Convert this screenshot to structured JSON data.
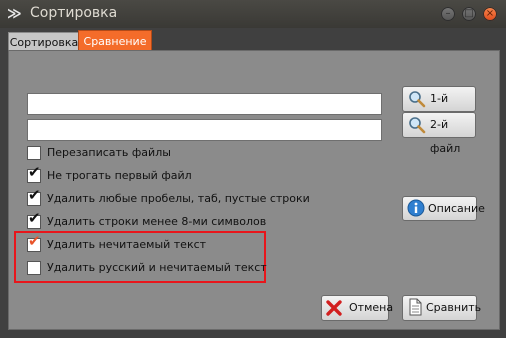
{
  "window": {
    "title": "Сортировка"
  },
  "tabs": [
    {
      "label": "Сортировка",
      "active": false
    },
    {
      "label": "Сравнение",
      "active": true
    }
  ],
  "fields": {
    "file1_value": "",
    "file2_value": ""
  },
  "buttons": {
    "file1": "1-й файл",
    "file2": "2-й файл",
    "description": "Описание",
    "cancel": "Отмена",
    "compare": "Сравнить"
  },
  "options": [
    {
      "label": "Перезаписать файлы",
      "checked": false
    },
    {
      "label": "Не трогать первый файл",
      "checked": true
    },
    {
      "label": "Удалить любые пробелы, таб, пустые строки",
      "checked": true
    },
    {
      "label": "Удалить строки менее 8-ми символов",
      "checked": true
    },
    {
      "label": "Удалить нечитаемый текст",
      "checked": true
    },
    {
      "label": "Удалить русский и нечитаемый текст",
      "checked": false
    }
  ],
  "colors": {
    "accent": "#f46c2a",
    "highlight_border": "#e8161b",
    "panel_bg": "#8b8b8b"
  }
}
